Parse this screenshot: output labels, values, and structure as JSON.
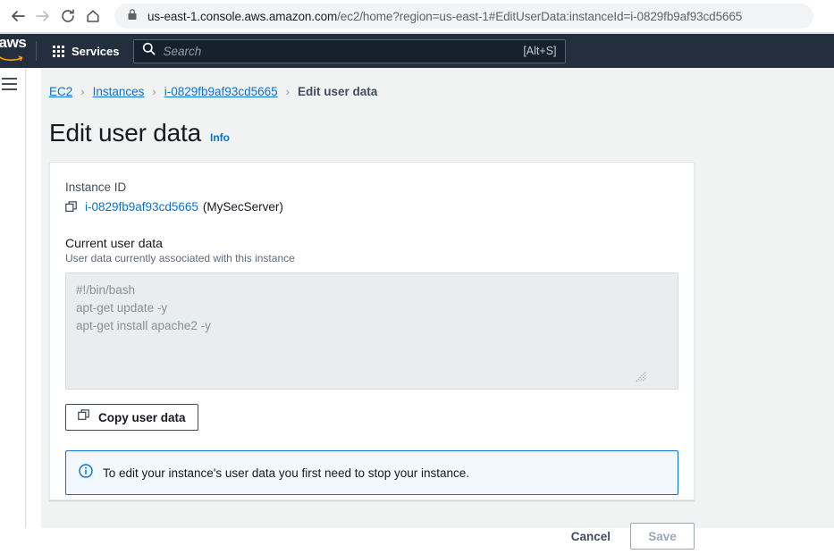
{
  "browser": {
    "back_icon": "back-arrow-icon",
    "forward_icon": "forward-arrow-icon",
    "reload_icon": "reload-icon",
    "home_icon": "home-icon",
    "lock_icon": "lock-icon",
    "url_domain": "us-east-1.console.aws.amazon.com",
    "url_path": "/ec2/home?region=us-east-1#EditUserData:instanceId=i-0829fb9af93cd5665"
  },
  "aws_nav": {
    "logo_text": "aws",
    "services_label": "Services",
    "services_icon": "grid-menu-icon",
    "search_icon": "search-icon",
    "search_placeholder": "Search",
    "search_shortcut": "[Alt+S]"
  },
  "sidebar": {
    "menu_icon": "hamburger-menu-icon"
  },
  "breadcrumb": {
    "items": [
      {
        "label": "EC2",
        "current": false
      },
      {
        "label": "Instances",
        "current": false
      },
      {
        "label": "i-0829fb9af93cd5665",
        "current": false
      },
      {
        "label": "Edit user data",
        "current": true
      }
    ],
    "separator": "›"
  },
  "header": {
    "title": "Edit user data",
    "info_label": "Info"
  },
  "card": {
    "instance_id_label": "Instance ID",
    "instance_copy_icon": "copy-icon",
    "instance_id_value": "i-0829fb9af93cd5665",
    "instance_name": "(MySecServer)",
    "current_user_data_label": "Current user data",
    "current_user_data_description": "User data currently associated with this instance",
    "user_data_content": "#!/bin/bash\napt-get update -y\napt-get install apache2 -y",
    "copy_button_icon": "copy-icon",
    "copy_button_label": "Copy user data",
    "alert_icon": "info-circle-icon",
    "alert_text": "To edit your instance's user data you first need to stop your instance."
  },
  "footer": {
    "cancel_label": "Cancel",
    "save_label": "Save"
  },
  "colors": {
    "aws_nav_background": "#232f3e",
    "link_blue": "#0972d3",
    "page_background": "#f1f3f3",
    "textarea_background": "#eaeded",
    "alert_background": "#f2f8fd"
  }
}
